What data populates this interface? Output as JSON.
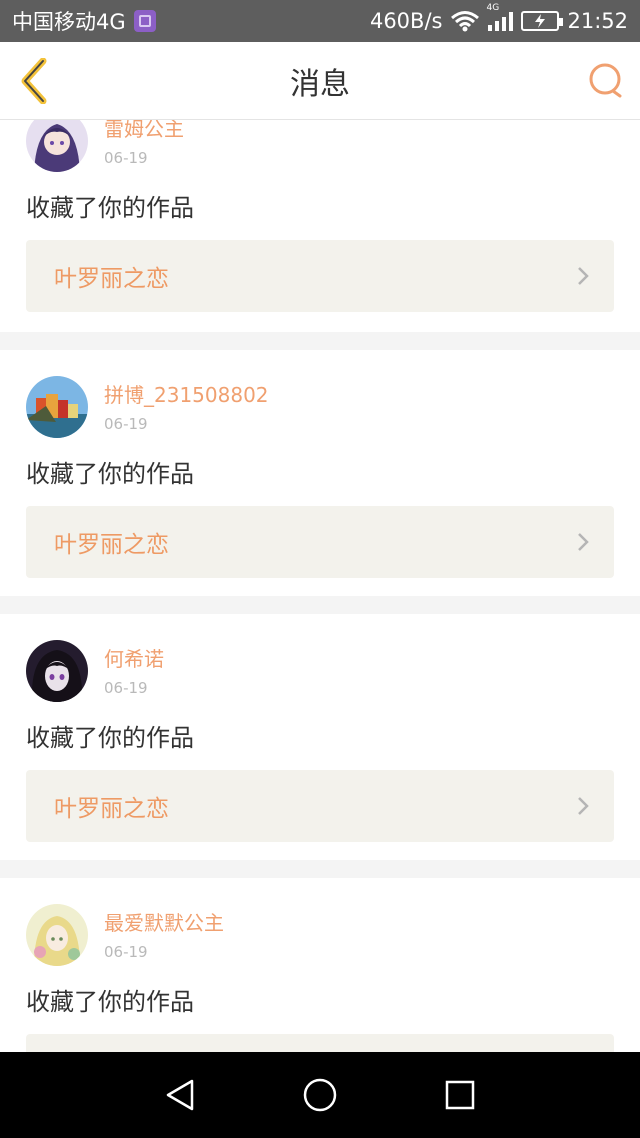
{
  "status_bar": {
    "carrier": "中国移动4G",
    "speed": "460B/s",
    "network_tag": "4G",
    "time": "21:52"
  },
  "header": {
    "title": "消息"
  },
  "messages": [
    {
      "username": "雷姆公主",
      "date": "06-19",
      "action": "收藏了你的作品",
      "work_title": "叶罗丽之恋"
    },
    {
      "username": "拼博_231508802",
      "date": "06-19",
      "action": "收藏了你的作品",
      "work_title": "叶罗丽之恋"
    },
    {
      "username": "何希诺",
      "date": "06-19",
      "action": "收藏了你的作品",
      "work_title": "叶罗丽之恋"
    },
    {
      "username": "最爱默默公主",
      "date": "06-19",
      "action": "收藏了你的作品",
      "work_title": ""
    }
  ],
  "colors": {
    "accent": "#ee9a64",
    "username": "#f0a070",
    "status_bar": "#5e5e5e",
    "work_bg": "#f3f2ec"
  },
  "icons": {
    "back": "chevron-left-icon",
    "search": "search-icon",
    "nav_back": "triangle-back-icon",
    "nav_home": "circle-home-icon",
    "nav_recent": "square-recent-icon"
  }
}
